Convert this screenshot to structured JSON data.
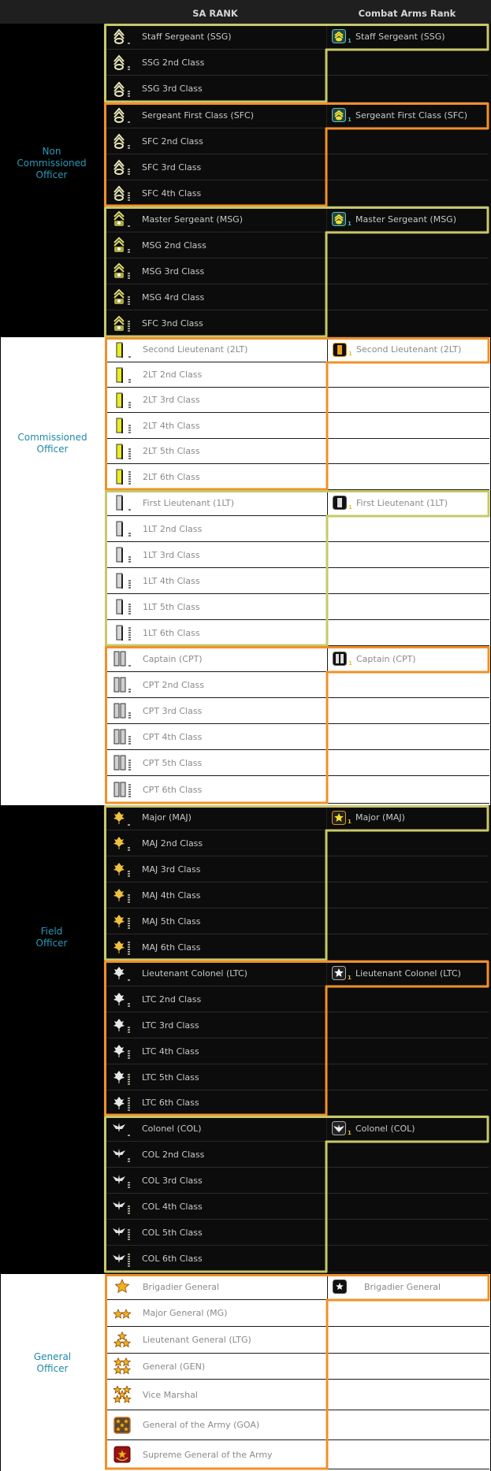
{
  "header": {
    "sa_rank": "SA RANK",
    "combat_arms_rank": "Combat Arms Rank"
  },
  "colors": {
    "yellow_outline": "#c8c86a",
    "orange_outline": "#f0902a",
    "category_text": "#2b99b8"
  },
  "sections": [
    {
      "category": [
        "Non",
        "Commissioned",
        "Officer"
      ],
      "theme": "dark",
      "groups": [
        {
          "outline": "yellow",
          "icon": "staff-sergeant-chevron-icon",
          "combat_arms": {
            "label": "Staff Sergeant (SSG)",
            "icon": "ssg-badge-icon",
            "num": "1"
          },
          "rows": [
            "Staff Sergeant (SSG)",
            "SSG 2nd Class",
            "SSG 3rd Class"
          ]
        },
        {
          "outline": "orange",
          "icon": "sergeant-first-class-chevron-icon",
          "combat_arms": {
            "label": "Sergeant First Class (SFC)",
            "icon": "sfc-badge-icon",
            "num": "1"
          },
          "rows": [
            "Sergeant First Class (SFC)",
            "SFC 2nd Class",
            "SFC 3rd Class",
            "SFC 4th Class"
          ]
        },
        {
          "outline": "yellow",
          "icon": "master-sergeant-chevron-icon",
          "combat_arms": {
            "label": "Master Sergeant (MSG)",
            "icon": "msg-badge-icon",
            "num": "1"
          },
          "rows": [
            "Master Sergeant (MSG)",
            "MSG 2nd Class",
            "MSG 3rd Class",
            "MSG 4rd Class",
            "SFC 3nd Class"
          ]
        }
      ]
    },
    {
      "category": [
        "Commissioned",
        "Officer"
      ],
      "theme": "light",
      "groups": [
        {
          "outline": "orange",
          "icon": "gold-bar-icon",
          "combat_arms": {
            "label": "Second Lieutenant (2LT)",
            "icon": "2lt-badge-icon",
            "num": "1"
          },
          "rows": [
            "Second Lieutenant (2LT)",
            "2LT 2nd Class",
            "2LT 3rd Class",
            "2LT 4th Class",
            "2LT 5th Class",
            "2LT 6th Class"
          ]
        },
        {
          "outline": "yellow",
          "icon": "silver-bar-icon",
          "combat_arms": {
            "label": "First Lieutenant (1LT)",
            "icon": "1lt-badge-icon",
            "num": "1"
          },
          "rows": [
            "First Lieutenant (1LT)",
            "1LT 2nd Class",
            "1LT 3rd Class",
            "1LT 4th Class",
            "1LT 5th Class",
            "1LT 6th Class"
          ]
        },
        {
          "outline": "orange",
          "icon": "double-silver-bar-icon",
          "combat_arms": {
            "label": "Captain (CPT)",
            "icon": "cpt-badge-icon",
            "num": "1"
          },
          "rows": [
            "Captain (CPT)",
            "CPT 2nd Class",
            "CPT 3rd Class",
            "CPT 4th Class",
            "CPT 5th Class",
            "CPT 6th Class"
          ]
        }
      ]
    },
    {
      "category": [
        "Field",
        "Officer"
      ],
      "theme": "dark",
      "groups": [
        {
          "outline": "yellow",
          "icon": "gold-oak-leaf-icon",
          "combat_arms": {
            "label": "Major (MAJ)",
            "icon": "maj-badge-icon",
            "num": "1"
          },
          "rows": [
            "Major (MAJ)",
            "MAJ 2nd Class",
            "MAJ 3rd Class",
            "MAJ 4th Class",
            "MAJ 5th Class",
            "MAJ 6th Class"
          ]
        },
        {
          "outline": "orange",
          "icon": "silver-oak-leaf-icon",
          "combat_arms": {
            "label": "Lieutenant Colonel (LTC)",
            "icon": "ltc-badge-icon",
            "num": "1"
          },
          "rows": [
            "Lieutenant Colonel (LTC)",
            "LTC 2nd Class",
            "LTC 3rd Class",
            "LTC 4th Class",
            "LTC 5th Class",
            "LTC 6th Class"
          ]
        },
        {
          "outline": "yellow",
          "icon": "eagle-icon",
          "combat_arms": {
            "label": "Colonel (COL)",
            "icon": "col-badge-icon",
            "num": "1"
          },
          "rows": [
            "Colonel (COL)",
            "COL 2nd Class",
            "COL 3rd Class",
            "COL 4th Class",
            "COL 5th Class",
            "COL 6th Class"
          ]
        }
      ]
    },
    {
      "category": [
        "General",
        "Officer"
      ],
      "theme": "light",
      "groups": [
        {
          "outline": "orange",
          "icon": "star-icon",
          "combat_arms": {
            "label": "Brigadier General",
            "icon": "bg-badge-icon",
            "num": ""
          },
          "rows": [
            "Brigadier General",
            "Major General (MG)",
            "Lieutenant General (LTG)",
            "General (GEN)",
            "Vice Marshal",
            "General of the Army (GOA)",
            "Supreme General of the Army"
          ],
          "row_icons": [
            "one-star-icon",
            "two-star-icon",
            "three-star-icon",
            "four-star-icon",
            "five-star-icon",
            "general-of-the-army-icon",
            "supreme-general-icon"
          ]
        }
      ]
    }
  ]
}
